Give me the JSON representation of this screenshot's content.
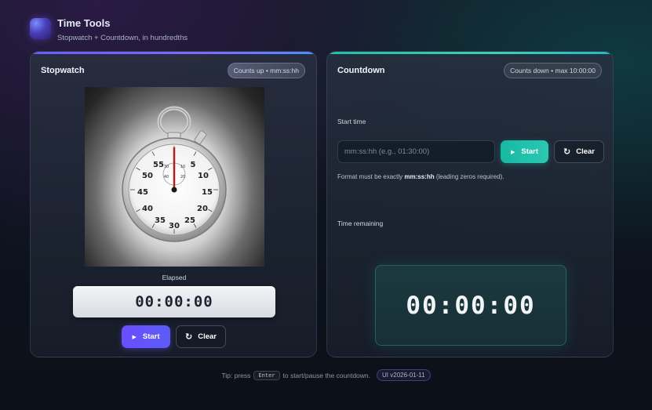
{
  "app": {
    "title": "Time Tools",
    "subtitle": "Stopwatch + Countdown, in hundredths"
  },
  "stopwatch": {
    "title": "Stopwatch",
    "badge": "Counts up • mm:ss:hh",
    "elapsed_label": "Elapsed",
    "display": "00:00:00",
    "start_label": "Start",
    "clear_label": "Clear",
    "dial_numbers": [
      "55",
      "5",
      "50",
      "10",
      "45",
      "15",
      "40",
      "20",
      "35",
      "25",
      "30"
    ],
    "inner_dial_numbers": [
      "30",
      "10",
      "20",
      "40"
    ]
  },
  "countdown": {
    "title": "Countdown",
    "badge": "Counts down • max 10:00:00",
    "start_time_label": "Start time",
    "input_value": "",
    "input_placeholder": "mm:ss:hh (e.g., 01:30:00)",
    "start_label": "Start",
    "clear_label": "Clear",
    "hint_prefix": "Format must be exactly ",
    "hint_format": "mm:ss:hh",
    "hint_suffix": " (leading zeros required).",
    "remaining_label": "Time remaining",
    "display": "00:00:00"
  },
  "footer": {
    "tip_prefix": "Tip: press",
    "key": "Enter",
    "tip_suffix": "to start/pause the countdown.",
    "version": "UI v2026-01-11"
  },
  "colors": {
    "stopwatch_accent": "#6b4dff",
    "countdown_accent": "#1fc0a8"
  },
  "icons": {
    "start": "play-icon",
    "clear": "reset-icon"
  }
}
